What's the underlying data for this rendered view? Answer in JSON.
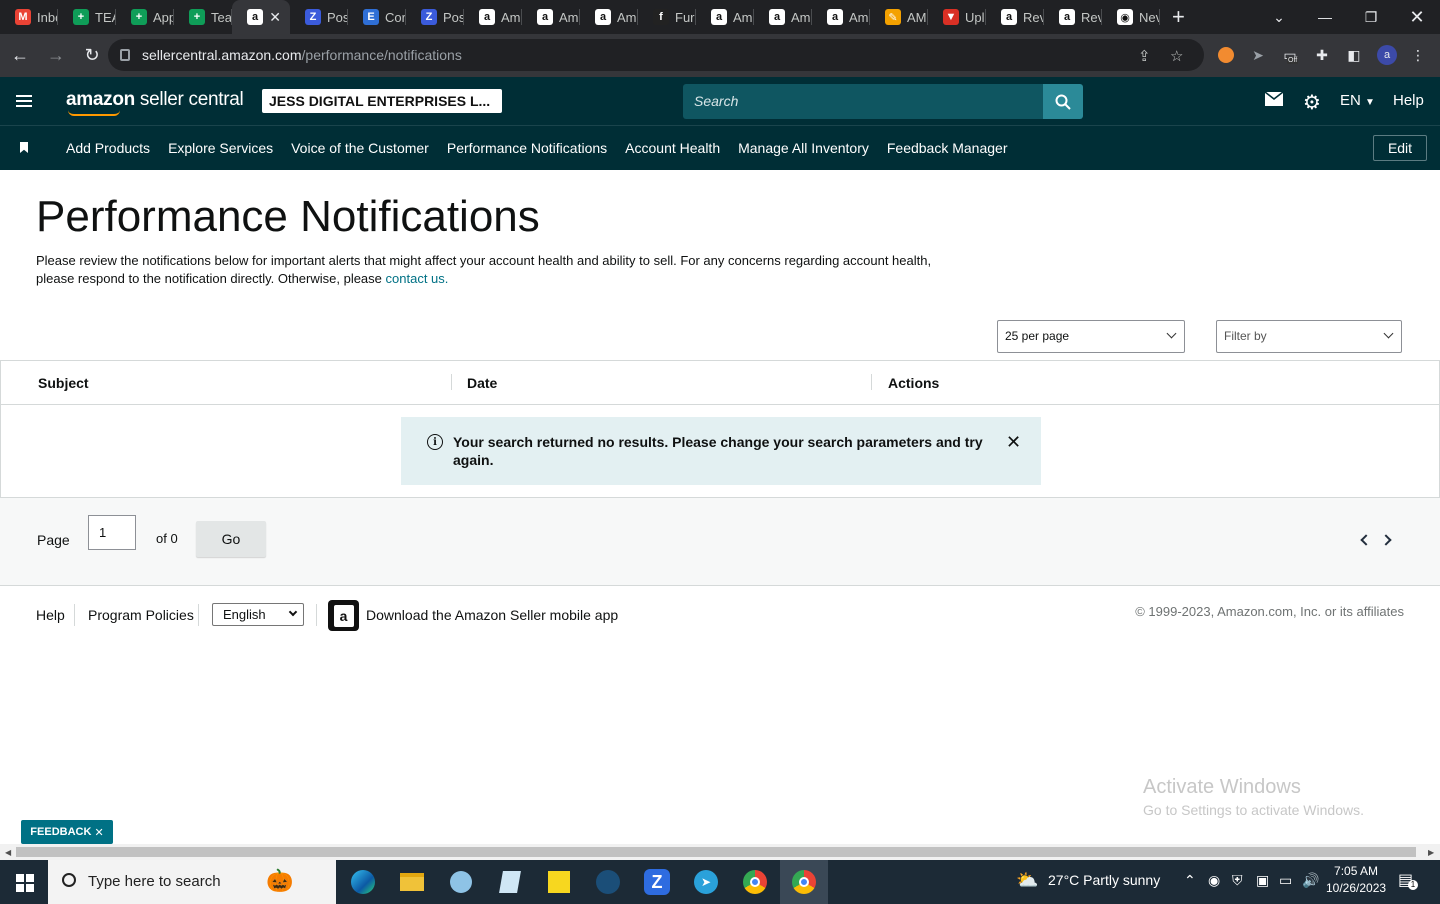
{
  "browser": {
    "tabs": [
      {
        "label": "Inbo",
        "icon": "gmail-icon",
        "color": "#ea4335",
        "glyph": "M"
      },
      {
        "label": "TEA",
        "icon": "sheets-icon",
        "color": "#0f9d58",
        "glyph": "+"
      },
      {
        "label": "App",
        "icon": "sheets-icon",
        "color": "#0f9d58",
        "glyph": "+"
      },
      {
        "label": "Tea",
        "icon": "sheets-icon",
        "color": "#0f9d58",
        "glyph": "+"
      },
      {
        "label": "",
        "icon": "amazon-icon",
        "color": "#ffffff",
        "glyph": "a",
        "active": true
      },
      {
        "label": "Pos",
        "icon": "zoho-icon",
        "color": "#3b5bdb",
        "glyph": "Z"
      },
      {
        "label": "Cor",
        "icon": "e-icon",
        "color": "#2f6fd6",
        "glyph": "E"
      },
      {
        "label": "Pos",
        "icon": "zoho-icon",
        "color": "#3b5bdb",
        "glyph": "Z"
      },
      {
        "label": "Am",
        "icon": "amazon-icon",
        "color": "#ffffff",
        "glyph": "a"
      },
      {
        "label": "Am",
        "icon": "amazon-icon",
        "color": "#ffffff",
        "glyph": "a"
      },
      {
        "label": "Am",
        "icon": "amazon-icon",
        "color": "#ffffff",
        "glyph": "a"
      },
      {
        "label": "Fur",
        "icon": "f-icon",
        "color": "#222222",
        "glyph": "f"
      },
      {
        "label": "Am",
        "icon": "amazon-icon",
        "color": "#ffffff",
        "glyph": "a"
      },
      {
        "label": "Am",
        "icon": "amazon-icon",
        "color": "#ffffff",
        "glyph": "a"
      },
      {
        "label": "Am",
        "icon": "amazon-icon",
        "color": "#ffffff",
        "glyph": "a"
      },
      {
        "label": "AM",
        "icon": "pencil-icon",
        "color": "#f4a100",
        "glyph": "✎"
      },
      {
        "label": "Upl",
        "icon": "shield-icon",
        "color": "#d93025",
        "glyph": "▼"
      },
      {
        "label": "Rev",
        "icon": "amazon-icon",
        "color": "#ffffff",
        "glyph": "a"
      },
      {
        "label": "Rev",
        "icon": "amazon-icon",
        "color": "#ffffff",
        "glyph": "a"
      },
      {
        "label": "Nev",
        "icon": "chrome-icon",
        "color": "#ffffff",
        "glyph": "◉"
      }
    ],
    "url_host": "sellercentral.amazon.com",
    "url_path": "/performance/notifications",
    "profile_initial": "a",
    "extension_badge": "Off"
  },
  "header": {
    "logo_prefix": "amazon",
    "logo_suffix": " seller central",
    "store_name": "JESS DIGITAL ENTERPRISES L...",
    "search_placeholder": "Search",
    "language": "EN",
    "help": "Help"
  },
  "nav": {
    "items": [
      "Add Products",
      "Explore Services",
      "Voice of the Customer",
      "Performance Notifications",
      "Account Health",
      "Manage All Inventory",
      "Feedback Manager"
    ],
    "edit_label": "Edit"
  },
  "main": {
    "title": "Performance Notifications",
    "intro_text": "Please review the notifications below for important alerts that might affect your account health and ability to sell. For any concerns regarding account health, please respond to the notification directly. Otherwise, please ",
    "intro_link": "contact us.",
    "per_page": "25 per page",
    "filter_placeholder": "Filter by",
    "table": {
      "columns": [
        "Subject",
        "Date",
        "Actions"
      ],
      "empty_message": "Your search returned no results. Please change your search parameters and try again."
    },
    "pager": {
      "page_label": "Page",
      "page_value": "1",
      "of_label": "of 0",
      "go_label": "Go"
    }
  },
  "footer": {
    "help": "Help",
    "program_policies": "Program Policies",
    "language": "English",
    "app_text": "Download the Amazon Seller mobile app",
    "copyright": "© 1999-2023, Amazon.com, Inc. or its affiliates"
  },
  "feedback_label": "FEEDBACK",
  "watermark": {
    "line1": "Activate Windows",
    "line2": "Go to Settings to activate Windows."
  },
  "taskbar": {
    "search_placeholder": "Type here to search",
    "weather": "27°C  Partly sunny",
    "time": "7:05 AM",
    "date": "10/26/2023",
    "notification_count": "1"
  },
  "colors": {
    "header_bg": "#002e36",
    "search_btn": "#2b8a98",
    "link": "#007185",
    "alert_bg": "#e3f0f2"
  }
}
